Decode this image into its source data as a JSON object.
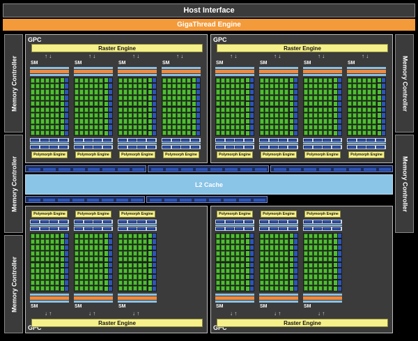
{
  "host_interface": "Host Interface",
  "gigathread_engine": "GigaThread Engine",
  "memory_controller": "Memory Controller",
  "l2_cache": "L2 Cache",
  "gpc_label": "GPC",
  "raster_engine": "Raster Engine",
  "sm_label": "SM",
  "polymorph_engine": "Polymorph Engine"
}
